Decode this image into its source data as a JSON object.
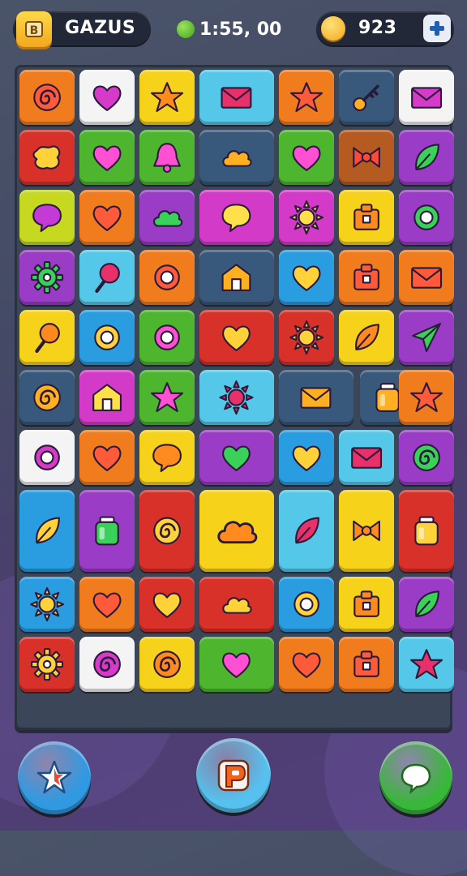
{
  "header": {
    "player_name": "GAZUS",
    "timer": "1:55, 00",
    "coins": "923"
  },
  "colors": {
    "red": "#d7312a",
    "orange": "#f07c1e",
    "yellow": "#f7d21b",
    "green": "#4db52e",
    "blue": "#2a9ce0",
    "cyan": "#55c8ea",
    "purple": "#9a3cc6",
    "magenta": "#d43ac8",
    "white": "#f4f4f4",
    "navy": "#38597c",
    "brown": "#b55a20",
    "lime": "#c6d920"
  },
  "board": {
    "tiles": [
      {
        "c": "orange",
        "i": "swirl",
        "r": 0,
        "col": 0
      },
      {
        "c": "white",
        "i": "heart",
        "r": 0,
        "col": 1
      },
      {
        "c": "yellow",
        "i": "star",
        "r": 0,
        "col": 2
      },
      {
        "c": "cyan",
        "i": "envelope",
        "r": 0,
        "col": 3,
        "w": 1.35
      },
      {
        "c": "orange",
        "i": "star",
        "r": 0,
        "col": 4
      },
      {
        "c": "navy",
        "i": "key",
        "r": 0,
        "col": 5
      },
      {
        "c": "white",
        "i": "envelope",
        "r": 0,
        "col": 6
      },
      {
        "c": "red",
        "i": "blob",
        "r": 1,
        "col": 0
      },
      {
        "c": "green",
        "i": "heart",
        "r": 1,
        "col": 1
      },
      {
        "c": "green",
        "i": "bell",
        "r": 1,
        "col": 2
      },
      {
        "c": "navy",
        "i": "cloud",
        "r": 1,
        "col": 3,
        "w": 1.35
      },
      {
        "c": "green",
        "i": "heart",
        "r": 1,
        "col": 4
      },
      {
        "c": "brown",
        "i": "bow",
        "r": 1,
        "col": 5
      },
      {
        "c": "purple",
        "i": "leaf",
        "r": 1,
        "col": 6
      },
      {
        "c": "lime",
        "i": "bubble",
        "r": 2,
        "col": 0
      },
      {
        "c": "orange",
        "i": "heart",
        "r": 2,
        "col": 1
      },
      {
        "c": "purple",
        "i": "cloud",
        "r": 2,
        "col": 2
      },
      {
        "c": "magenta",
        "i": "bubble",
        "r": 2,
        "col": 3,
        "w": 1.35
      },
      {
        "c": "magenta",
        "i": "sun",
        "r": 2,
        "col": 4
      },
      {
        "c": "yellow",
        "i": "box",
        "r": 2,
        "col": 5
      },
      {
        "c": "purple",
        "i": "ring",
        "r": 2,
        "col": 6
      },
      {
        "c": "purple",
        "i": "gear",
        "r": 3,
        "col": 0
      },
      {
        "c": "cyan",
        "i": "lollipop",
        "r": 3,
        "col": 1
      },
      {
        "c": "orange",
        "i": "ring",
        "r": 3,
        "col": 2
      },
      {
        "c": "navy",
        "i": "house",
        "r": 3,
        "col": 3,
        "w": 1.35
      },
      {
        "c": "blue",
        "i": "heart",
        "r": 3,
        "col": 4
      },
      {
        "c": "orange",
        "i": "box",
        "r": 3,
        "col": 5
      },
      {
        "c": "orange",
        "i": "envelope",
        "r": 3,
        "col": 6
      },
      {
        "c": "yellow",
        "i": "lollipop",
        "r": 4,
        "col": 0
      },
      {
        "c": "blue",
        "i": "ring",
        "r": 4,
        "col": 1
      },
      {
        "c": "green",
        "i": "ring",
        "r": 4,
        "col": 2
      },
      {
        "c": "red",
        "i": "heart",
        "r": 4,
        "col": 3,
        "w": 1.35
      },
      {
        "c": "red",
        "i": "sun",
        "r": 4,
        "col": 4
      },
      {
        "c": "yellow",
        "i": "leaf",
        "r": 4,
        "col": 5
      },
      {
        "c": "purple",
        "i": "plane",
        "r": 4,
        "col": 6
      },
      {
        "c": "navy",
        "i": "swirl",
        "r": 5,
        "col": 0
      },
      {
        "c": "magenta",
        "i": "house",
        "r": 5,
        "col": 1
      },
      {
        "c": "green",
        "i": "star",
        "r": 5,
        "col": 2
      },
      {
        "c": "cyan",
        "i": "sun",
        "r": 5,
        "col": 3,
        "w": 1.35
      },
      {
        "c": "navy",
        "i": "envelope",
        "r": 5,
        "col": 4,
        "w": 1.35
      },
      {
        "c": "navy",
        "i": "jar",
        "r": 5,
        "col": 5.35
      },
      {
        "c": "orange",
        "i": "star",
        "r": 5,
        "col": 6
      },
      {
        "c": "white",
        "i": "ring",
        "r": 6,
        "col": 0
      },
      {
        "c": "orange",
        "i": "heart",
        "r": 6,
        "col": 1
      },
      {
        "c": "yellow",
        "i": "bubble",
        "r": 6,
        "col": 2
      },
      {
        "c": "purple",
        "i": "heart",
        "r": 6,
        "col": 3,
        "w": 1.35
      },
      {
        "c": "blue",
        "i": "heart",
        "r": 6,
        "col": 4
      },
      {
        "c": "cyan",
        "i": "envelope",
        "r": 6,
        "col": 5
      },
      {
        "c": "purple",
        "i": "swirl",
        "r": 6,
        "col": 6
      },
      {
        "c": "blue",
        "i": "leaf",
        "r": 7,
        "col": 0,
        "h": 1.45
      },
      {
        "c": "purple",
        "i": "jar",
        "r": 7,
        "col": 1,
        "h": 1.45
      },
      {
        "c": "red",
        "i": "swirl",
        "r": 7,
        "col": 2,
        "h": 1.45
      },
      {
        "c": "yellow",
        "i": "cloud",
        "r": 7,
        "col": 3,
        "w": 1.35,
        "h": 1.45
      },
      {
        "c": "cyan",
        "i": "leaf",
        "r": 7,
        "col": 4,
        "h": 1.45
      },
      {
        "c": "yellow",
        "i": "bow",
        "r": 7,
        "col": 5,
        "h": 1.45
      },
      {
        "c": "red",
        "i": "jar",
        "r": 7,
        "col": 6,
        "h": 1.45
      },
      {
        "c": "blue",
        "i": "sun",
        "r": 8.45,
        "col": 0
      },
      {
        "c": "orange",
        "i": "heart",
        "r": 8.45,
        "col": 1
      },
      {
        "c": "red",
        "i": "heart",
        "r": 8.45,
        "col": 2
      },
      {
        "c": "red",
        "i": "cloud",
        "r": 8.45,
        "col": 3,
        "w": 1.35
      },
      {
        "c": "blue",
        "i": "ring",
        "r": 8.45,
        "col": 4
      },
      {
        "c": "yellow",
        "i": "box",
        "r": 8.45,
        "col": 5
      },
      {
        "c": "purple",
        "i": "leaf",
        "r": 8.45,
        "col": 6
      },
      {
        "c": "red",
        "i": "gear",
        "r": 9.45,
        "col": 0
      },
      {
        "c": "white",
        "i": "swirl",
        "r": 9.45,
        "col": 1
      },
      {
        "c": "yellow",
        "i": "swirl",
        "r": 9.45,
        "col": 2
      },
      {
        "c": "green",
        "i": "heart",
        "r": 9.45,
        "col": 3,
        "w": 1.35
      },
      {
        "c": "orange",
        "i": "heart",
        "r": 9.45,
        "col": 4
      },
      {
        "c": "orange",
        "i": "box",
        "r": 9.45,
        "col": 5
      },
      {
        "c": "cyan",
        "i": "star",
        "r": 9.45,
        "col": 6
      }
    ]
  },
  "bottom_buttons": [
    {
      "name": "favorites-button",
      "icon": "star",
      "color": "#2f9ae2"
    },
    {
      "name": "play-button",
      "icon": "play",
      "color": "#56c1ee"
    },
    {
      "name": "chat-button",
      "icon": "chat",
      "color": "#39b73a"
    }
  ]
}
